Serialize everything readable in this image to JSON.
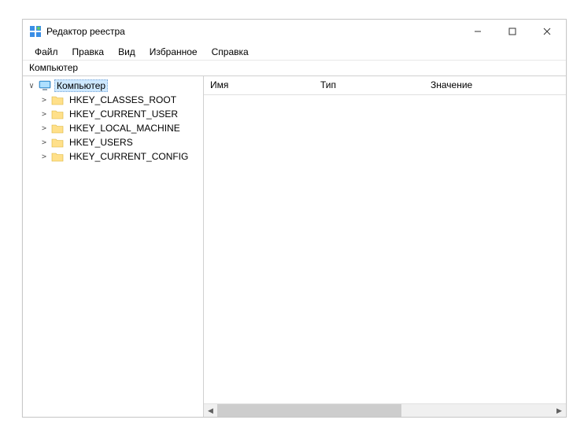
{
  "window": {
    "title": "Редактор реестра"
  },
  "menu": {
    "file": "Файл",
    "edit": "Правка",
    "view": "Вид",
    "favorites": "Избранное",
    "help": "Справка"
  },
  "address": "Компьютер",
  "tree": {
    "root": {
      "label": "Компьютер",
      "expanded": true,
      "selected": true
    },
    "children": [
      {
        "label": "HKEY_CLASSES_ROOT"
      },
      {
        "label": "HKEY_CURRENT_USER"
      },
      {
        "label": "HKEY_LOCAL_MACHINE"
      },
      {
        "label": "HKEY_USERS"
      },
      {
        "label": "HKEY_CURRENT_CONFIG"
      }
    ]
  },
  "columns": {
    "name": "Имя",
    "type": "Тип",
    "value": "Значение"
  },
  "icons": {
    "app": "registry-cubes-icon",
    "computer": "computer-icon",
    "folder": "folder-icon",
    "expander_open": "∨",
    "expander_closed": ">",
    "minimize": "—",
    "maximize": "☐",
    "close": "✕",
    "scroll_left": "◀",
    "scroll_right": "▶"
  }
}
